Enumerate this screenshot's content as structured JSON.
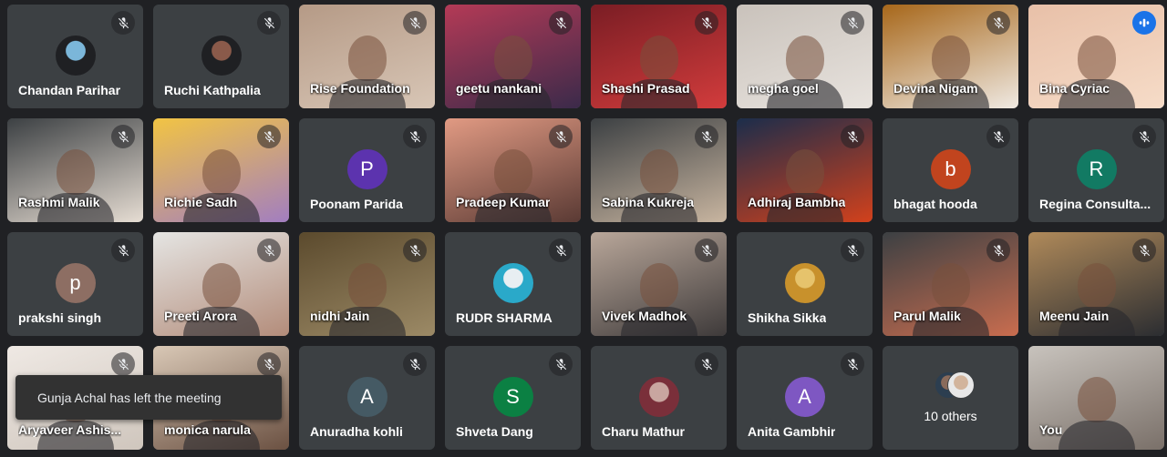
{
  "participants": [
    {
      "name": "Chandan Parihar",
      "type": "photo",
      "colors": [
        "#1f2023",
        "#7bb6d9"
      ]
    },
    {
      "name": "Ruchi Kathpalia",
      "type": "photo",
      "colors": [
        "#1f2023",
        "#8a5a4a"
      ]
    },
    {
      "name": "Rise Foundation",
      "type": "video",
      "colors": [
        "#b59a86",
        "#d8c6b6"
      ]
    },
    {
      "name": "geetu nankani",
      "type": "video",
      "colors": [
        "#b43a56",
        "#3b2a4a"
      ]
    },
    {
      "name": "Shashi Prasad",
      "type": "video",
      "colors": [
        "#7a1d24",
        "#d23c3c"
      ]
    },
    {
      "name": "megha goel",
      "type": "video",
      "colors": [
        "#c9c2bb",
        "#e8e3de"
      ]
    },
    {
      "name": "Devina Nigam",
      "type": "video",
      "colors": [
        "#a7671a",
        "#efe9e2"
      ]
    },
    {
      "name": "Bina Cyriac",
      "type": "video",
      "colors": [
        "#e8c0a8",
        "#f6dcc8"
      ],
      "speaking": true
    },
    {
      "name": "Rashmi Malik",
      "type": "video",
      "colors": [
        "#3c4043",
        "#e6ddd3"
      ]
    },
    {
      "name": "Richie Sadh",
      "type": "video",
      "colors": [
        "#f2c443",
        "#a27ec0"
      ]
    },
    {
      "name": "Poonam Parida",
      "type": "letter",
      "letter": "P",
      "color": "#5c33ae"
    },
    {
      "name": "Pradeep Kumar",
      "type": "video",
      "colors": [
        "#e19a83",
        "#5a3a34"
      ]
    },
    {
      "name": "Sabina Kukreja",
      "type": "video",
      "colors": [
        "#3c4043",
        "#c8b5a0"
      ]
    },
    {
      "name": "Adhiraj Bambha",
      "type": "video",
      "colors": [
        "#1b2d4b",
        "#d2411c"
      ]
    },
    {
      "name": "bhagat hooda",
      "type": "letter",
      "letter": "b",
      "color": "#c1441e"
    },
    {
      "name": "Regina Consulta...",
      "type": "letter",
      "letter": "R",
      "color": "#127a63"
    },
    {
      "name": "prakshi singh",
      "type": "letter",
      "letter": "p",
      "color": "#8d6e63"
    },
    {
      "name": "Preeti Arora",
      "type": "video",
      "colors": [
        "#e5e5e3",
        "#b38c7a"
      ]
    },
    {
      "name": "nidhi Jain",
      "type": "video",
      "colors": [
        "#5b4a2d",
        "#9c8a66"
      ]
    },
    {
      "name": "RUDR SHARMA",
      "type": "photo",
      "colors": [
        "#2aa9c9",
        "#e8eef2"
      ]
    },
    {
      "name": "Vivek Madhok",
      "type": "video",
      "colors": [
        "#b9a79a",
        "#3e3a3a"
      ]
    },
    {
      "name": "Shikha Sikka",
      "type": "photo",
      "colors": [
        "#c8912c",
        "#e6c36c"
      ]
    },
    {
      "name": "Parul Malik",
      "type": "video",
      "colors": [
        "#3c4043",
        "#c96d4f"
      ]
    },
    {
      "name": "Meenu Jain",
      "type": "video",
      "colors": [
        "#b08a5a",
        "#2b2d31"
      ]
    },
    {
      "name": "Aryaveer Ashis...",
      "type": "video",
      "colors": [
        "#efe9e4",
        "#cfc6bd"
      ]
    },
    {
      "name": "monica narula",
      "type": "video",
      "colors": [
        "#d9c8b6",
        "#6b5142"
      ]
    },
    {
      "name": "Anuradha kohli",
      "type": "letter",
      "letter": "A",
      "color": "#455a64"
    },
    {
      "name": "Shveta Dang",
      "type": "letter",
      "letter": "S",
      "color": "#0b8043"
    },
    {
      "name": "Charu Mathur",
      "type": "photo",
      "colors": [
        "#7a2f3a",
        "#c9a6a0"
      ]
    },
    {
      "name": "Anita Gambhir",
      "type": "letter",
      "letter": "A",
      "color": "#7e57c2"
    },
    {
      "name": "10 others",
      "type": "others"
    },
    {
      "name": "You",
      "type": "video",
      "colors": [
        "#c8c3bd",
        "#7a7069"
      ]
    }
  ],
  "toast": {
    "text": "Gunja Achal has left the meeting"
  },
  "icons": {
    "muted": "mic-off-icon",
    "speaking": "audio-level-icon"
  }
}
